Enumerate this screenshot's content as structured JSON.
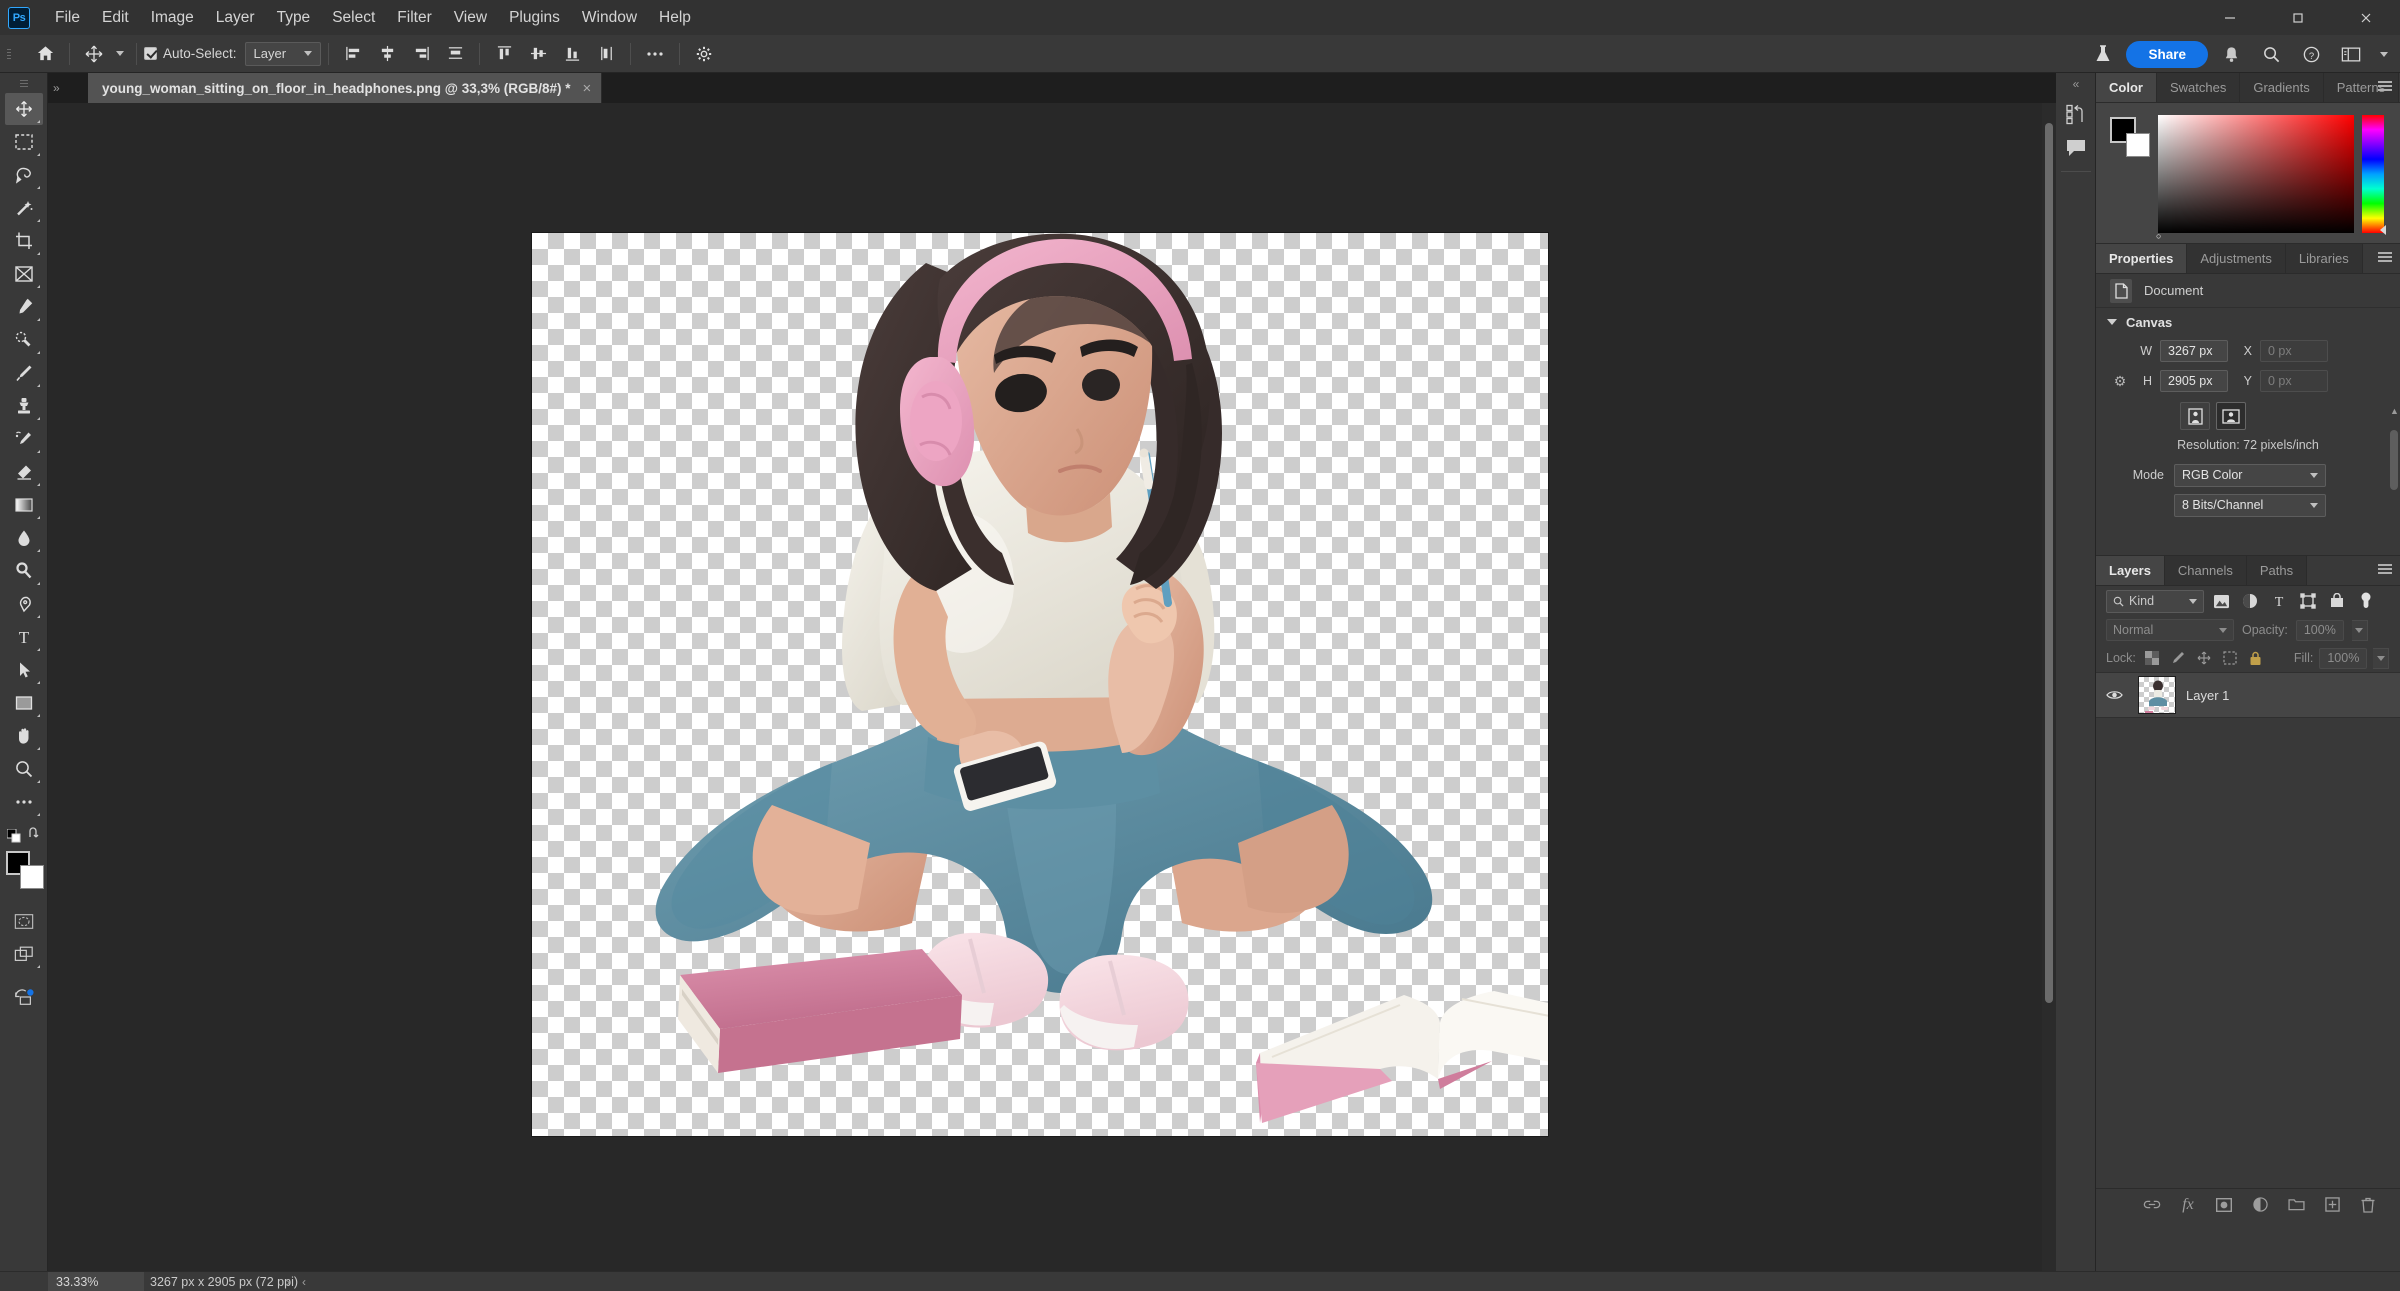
{
  "app": {
    "name": "Adobe Photoshop",
    "logo_text": "Ps"
  },
  "menubar": {
    "items": [
      "File",
      "Edit",
      "Image",
      "Layer",
      "Type",
      "Select",
      "Filter",
      "View",
      "Plugins",
      "Window",
      "Help"
    ],
    "window_controls": [
      "minimize",
      "maximize",
      "close"
    ]
  },
  "options_bar": {
    "home_icon": "home-icon",
    "tool_icon": "move-tool-icon",
    "auto_select_checked": true,
    "auto_select_label": "Auto-Select:",
    "auto_select_value": "Layer",
    "align_icons": [
      "align-left-edges",
      "align-horizontal-centers",
      "align-right-edges",
      "distribute-horizontal",
      "align-top-edges",
      "align-vertical-centers",
      "align-bottom-edges",
      "distribute-vertical"
    ],
    "more_label": "...",
    "settings_icon": "gear-icon",
    "right_icons": [
      "flask-icon",
      "bell-icon",
      "search-icon",
      "help-icon",
      "workspace-icon"
    ],
    "share_label": "Share"
  },
  "document_tab": {
    "title": "young_woman_sitting_on_floor_in_headphones.png @ 33,3% (RGB/8#) *",
    "close_glyph": "×",
    "collapse_glyph": "»"
  },
  "toolbar": {
    "tools": [
      {
        "name": "move-tool",
        "active": true
      },
      {
        "name": "rectangular-marquee-tool",
        "active": false
      },
      {
        "name": "lasso-tool",
        "active": false
      },
      {
        "name": "magic-wand-tool",
        "active": false
      },
      {
        "name": "crop-tool",
        "active": false
      },
      {
        "name": "frame-tool",
        "active": false
      },
      {
        "name": "eyedropper-tool",
        "active": false
      },
      {
        "name": "spot-healing-brush-tool",
        "active": false
      },
      {
        "name": "brush-tool",
        "active": false
      },
      {
        "name": "clone-stamp-tool",
        "active": false
      },
      {
        "name": "history-brush-tool",
        "active": false
      },
      {
        "name": "eraser-tool",
        "active": false
      },
      {
        "name": "gradient-tool",
        "active": false
      },
      {
        "name": "blur-tool",
        "active": false
      },
      {
        "name": "dodge-tool",
        "active": false
      },
      {
        "name": "pen-tool",
        "active": false
      },
      {
        "name": "type-tool",
        "active": false
      },
      {
        "name": "path-selection-tool",
        "active": false
      },
      {
        "name": "rectangle-tool",
        "active": false
      },
      {
        "name": "hand-tool",
        "active": false
      },
      {
        "name": "zoom-tool",
        "active": false
      },
      {
        "name": "edit-toolbar-tool",
        "active": false
      }
    ],
    "foreground_color": "#000000",
    "background_color": "#ffffff",
    "quick_mask": "quick-mask-mode",
    "screen_mode": "screen-mode"
  },
  "canvas": {
    "zoom_display": "33,3%",
    "artwork_description": "3D illustration of a young woman sitting cross-legged on the floor wearing pink headphones, white t-shirt and blue skirt, holding a pencil and a phone, with a pink closed book and an open white book on the floor",
    "colors": {
      "hair": "#3b3030",
      "headphones": "#e8a0bd",
      "shirt": "#eeece4",
      "skirt": "#5f8fa3",
      "skin": "#d9a289",
      "shoes": "#f3d8de",
      "book_pink": "#cf7d9c",
      "book_white": "#f2efe9",
      "pencil": "#6ea8c4"
    }
  },
  "right_narrow_dock": {
    "items": [
      "history-icon",
      "comments-icon"
    ],
    "collapse_glyph": "«"
  },
  "color_panel": {
    "tabs": [
      {
        "label": "Color",
        "active": true
      },
      {
        "label": "Swatches",
        "active": false
      },
      {
        "label": "Gradients",
        "active": false
      },
      {
        "label": "Patterns",
        "active": false
      }
    ],
    "foreground": "#000000",
    "background": "#ffffff",
    "menu_icon": "panel-menu-icon"
  },
  "properties_panel": {
    "tabs": [
      {
        "label": "Properties",
        "active": true
      },
      {
        "label": "Adjustments",
        "active": false
      },
      {
        "label": "Libraries",
        "active": false
      }
    ],
    "subject": "Document",
    "subject_icon": "document-icon",
    "section_title": "Canvas",
    "width_label": "W",
    "width_value": "3267 px",
    "x_label": "X",
    "x_value": "0 px",
    "height_label": "H",
    "height_value": "2905 px",
    "y_label": "Y",
    "y_value": "0 px",
    "orientation_portrait": "portrait-orientation-icon",
    "orientation_landscape": "landscape-orientation-icon",
    "resolution_line": "Resolution: 72 pixels/inch",
    "mode_label": "Mode",
    "mode_value": "RGB Color",
    "depth_value": "8 Bits/Channel"
  },
  "layers_panel": {
    "tabs": [
      {
        "label": "Layers",
        "active": true
      },
      {
        "label": "Channels",
        "active": false
      },
      {
        "label": "Paths",
        "active": false
      }
    ],
    "filter_label": "Kind",
    "filter_icons": [
      "filter-pixel-icon",
      "filter-adjustment-icon",
      "filter-type-icon",
      "filter-shape-icon",
      "filter-smart-object-icon",
      "filter-toggle-icon"
    ],
    "blend_mode": "Normal",
    "opacity_label": "Opacity:",
    "opacity_value": "100%",
    "lock_label": "Lock:",
    "lock_icons": [
      "lock-transparent-pixels-icon",
      "lock-image-pixels-icon",
      "lock-position-icon",
      "lock-artboard-nesting-icon",
      "lock-all-icon"
    ],
    "fill_label": "Fill:",
    "fill_value": "100%",
    "layers": [
      {
        "name": "Layer 1",
        "visible": true,
        "selected": true
      }
    ],
    "footer_icons": [
      "link-layers-icon",
      "layer-style-fx-icon",
      "add-layer-mask-icon",
      "new-adjustment-layer-icon",
      "new-group-icon",
      "new-layer-icon",
      "delete-layer-icon"
    ],
    "fx_label": "fx"
  },
  "status_bar": {
    "zoom": "33.33%",
    "doc_size": "3267 px x 2905 px (72 ppi)",
    "arrow_right": "›",
    "arrow_left": "‹"
  }
}
